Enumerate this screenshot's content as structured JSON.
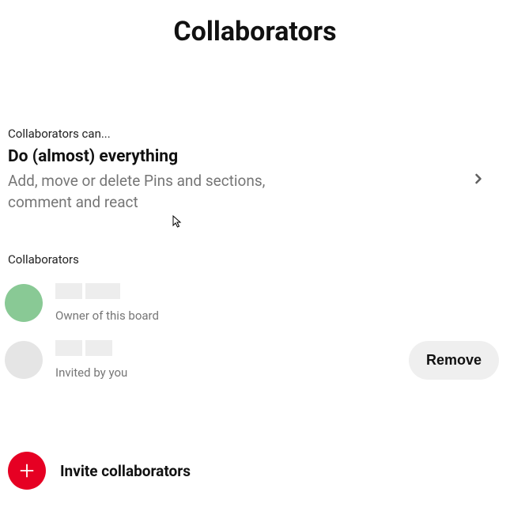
{
  "header": {
    "title": "Collaborators"
  },
  "permissions": {
    "section_label": "Collaborators can...",
    "title": "Do (almost) everything",
    "description": "Add, move or delete Pins and sections, comment and react"
  },
  "collaborators": {
    "section_label": "Collaborators",
    "remove_label": "Remove",
    "items": [
      {
        "subtitle": "Owner of this board",
        "avatar_color": "green",
        "removable": false
      },
      {
        "subtitle": "Invited by you",
        "avatar_color": "grey",
        "removable": true
      }
    ]
  },
  "invite": {
    "label": "Invite collaborators"
  }
}
